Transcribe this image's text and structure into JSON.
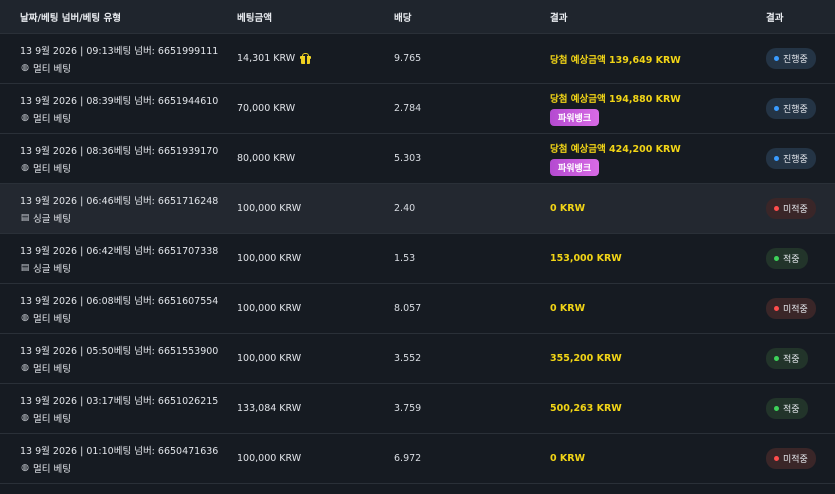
{
  "headers": {
    "date": "날짜/베팅 넘버/베팅 유형",
    "amount": "베팅금액",
    "odds": "배당",
    "result": "결과",
    "status": "결과"
  },
  "rows": [
    {
      "line1": "13 9월 2026 | 09:13베팅 넘버: 6651999111",
      "type": "멀티 베팅",
      "type_icon": "multi-bet-icon",
      "amount": "14,301 KRW",
      "gift": true,
      "odds": "9.765",
      "result": "당첨 예상금액 139,649 KRW",
      "powerbank": "",
      "status": "진행중",
      "status_kind": "progress"
    },
    {
      "line1": "13 9월 2026 | 08:39베팅 넘버: 6651944610",
      "type": "멀티 베팅",
      "type_icon": "multi-bet-icon",
      "amount": "70,000 KRW",
      "gift": false,
      "odds": "2.784",
      "result": "당첨 예상금액 194,880 KRW",
      "powerbank": "파워뱅크",
      "status": "진행중",
      "status_kind": "progress"
    },
    {
      "line1": "13 9월 2026 | 08:36베팅 넘버: 6651939170",
      "type": "멀티 베팅",
      "type_icon": "multi-bet-icon",
      "amount": "80,000 KRW",
      "gift": false,
      "odds": "5.303",
      "result": "당첨 예상금액 424,200 KRW",
      "powerbank": "파워뱅크",
      "status": "진행중",
      "status_kind": "progress"
    },
    {
      "line1": "13 9월 2026 | 06:46베팅 넘버: 6651716248",
      "type": "싱글 베팅",
      "type_icon": "single-bet-icon",
      "amount": "100,000 KRW",
      "gift": false,
      "odds": "2.40",
      "result": "0 KRW",
      "powerbank": "",
      "status": "미적중",
      "status_kind": "lose"
    },
    {
      "line1": "13 9월 2026 | 06:42베팅 넘버: 6651707338",
      "type": "싱글 베팅",
      "type_icon": "single-bet-icon",
      "amount": "100,000 KRW",
      "gift": false,
      "odds": "1.53",
      "result": "153,000 KRW",
      "powerbank": "",
      "status": "적중",
      "status_kind": "win"
    },
    {
      "line1": "13 9월 2026 | 06:08베팅 넘버: 6651607554",
      "type": "멀티 베팅",
      "type_icon": "multi-bet-icon",
      "amount": "100,000 KRW",
      "gift": false,
      "odds": "8.057",
      "result": "0 KRW",
      "powerbank": "",
      "status": "미적중",
      "status_kind": "lose"
    },
    {
      "line1": "13 9월 2026 | 05:50베팅 넘버: 6651553900",
      "type": "멀티 베팅",
      "type_icon": "multi-bet-icon",
      "amount": "100,000 KRW",
      "gift": false,
      "odds": "3.552",
      "result": "355,200 KRW",
      "powerbank": "",
      "status": "적중",
      "status_kind": "win"
    },
    {
      "line1": "13 9월 2026 | 03:17베팅 넘버: 6651026215",
      "type": "멀티 베팅",
      "type_icon": "multi-bet-icon",
      "amount": "133,084 KRW",
      "gift": false,
      "odds": "3.759",
      "result": "500,263 KRW",
      "powerbank": "",
      "status": "적중",
      "status_kind": "win"
    },
    {
      "line1": "13 9월 2026 | 01:10베팅 넘버: 6650471636",
      "type": "멀티 베팅",
      "type_icon": "multi-bet-icon",
      "amount": "100,000 KRW",
      "gift": false,
      "odds": "6.972",
      "result": "0 KRW",
      "powerbank": "",
      "status": "미적중",
      "status_kind": "lose"
    }
  ],
  "highlight_row": 3,
  "colors": {
    "result": "#f2d516",
    "progress_dot": "#3a9cff",
    "lose_dot": "#ff4d4d",
    "win_dot": "#3ed45a"
  }
}
